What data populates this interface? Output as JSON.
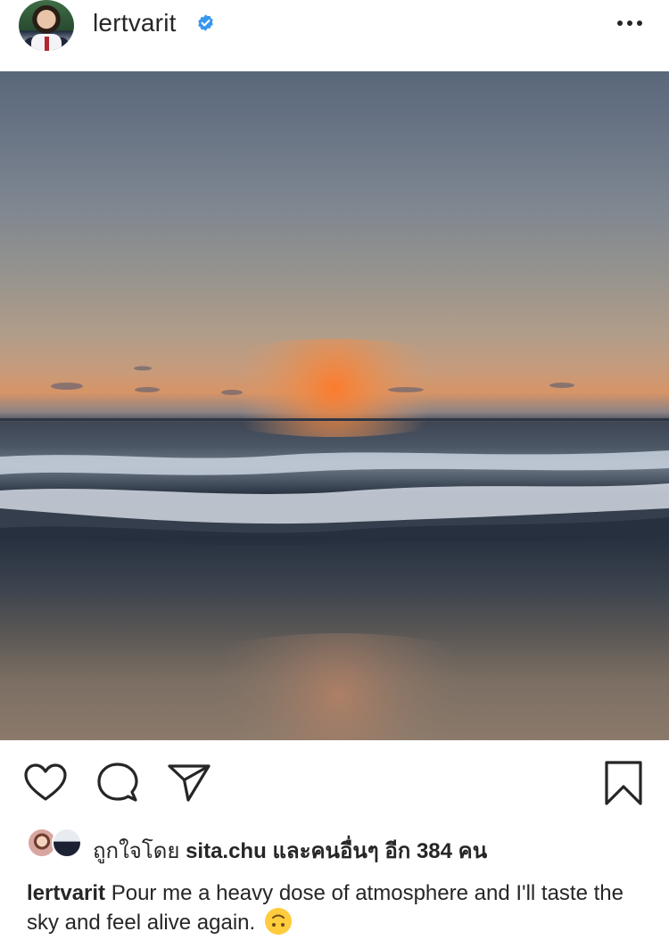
{
  "post": {
    "username": "lertvarit",
    "verified": true,
    "more_icon": "more-horizontal-icon"
  },
  "photo": {
    "description_icon": "photo"
  },
  "actions": {
    "like_icon": "heart-icon",
    "comment_icon": "comment-icon",
    "share_icon": "send-icon",
    "save_icon": "bookmark-icon"
  },
  "likes": {
    "prefix": "ถูกใจโดย",
    "user": "sita.chu",
    "suffix": "และคนอื่นๆ อีก 384 คน"
  },
  "caption": {
    "username": "lertvarit",
    "text": "Pour me a heavy dose of atmosphere and I'll taste the sky and feel alive again.",
    "emoji": "🙃"
  },
  "colors": {
    "text": "#262626",
    "verified_blue": "#3897f0",
    "emoji_yellow": "#ffcc3d"
  }
}
